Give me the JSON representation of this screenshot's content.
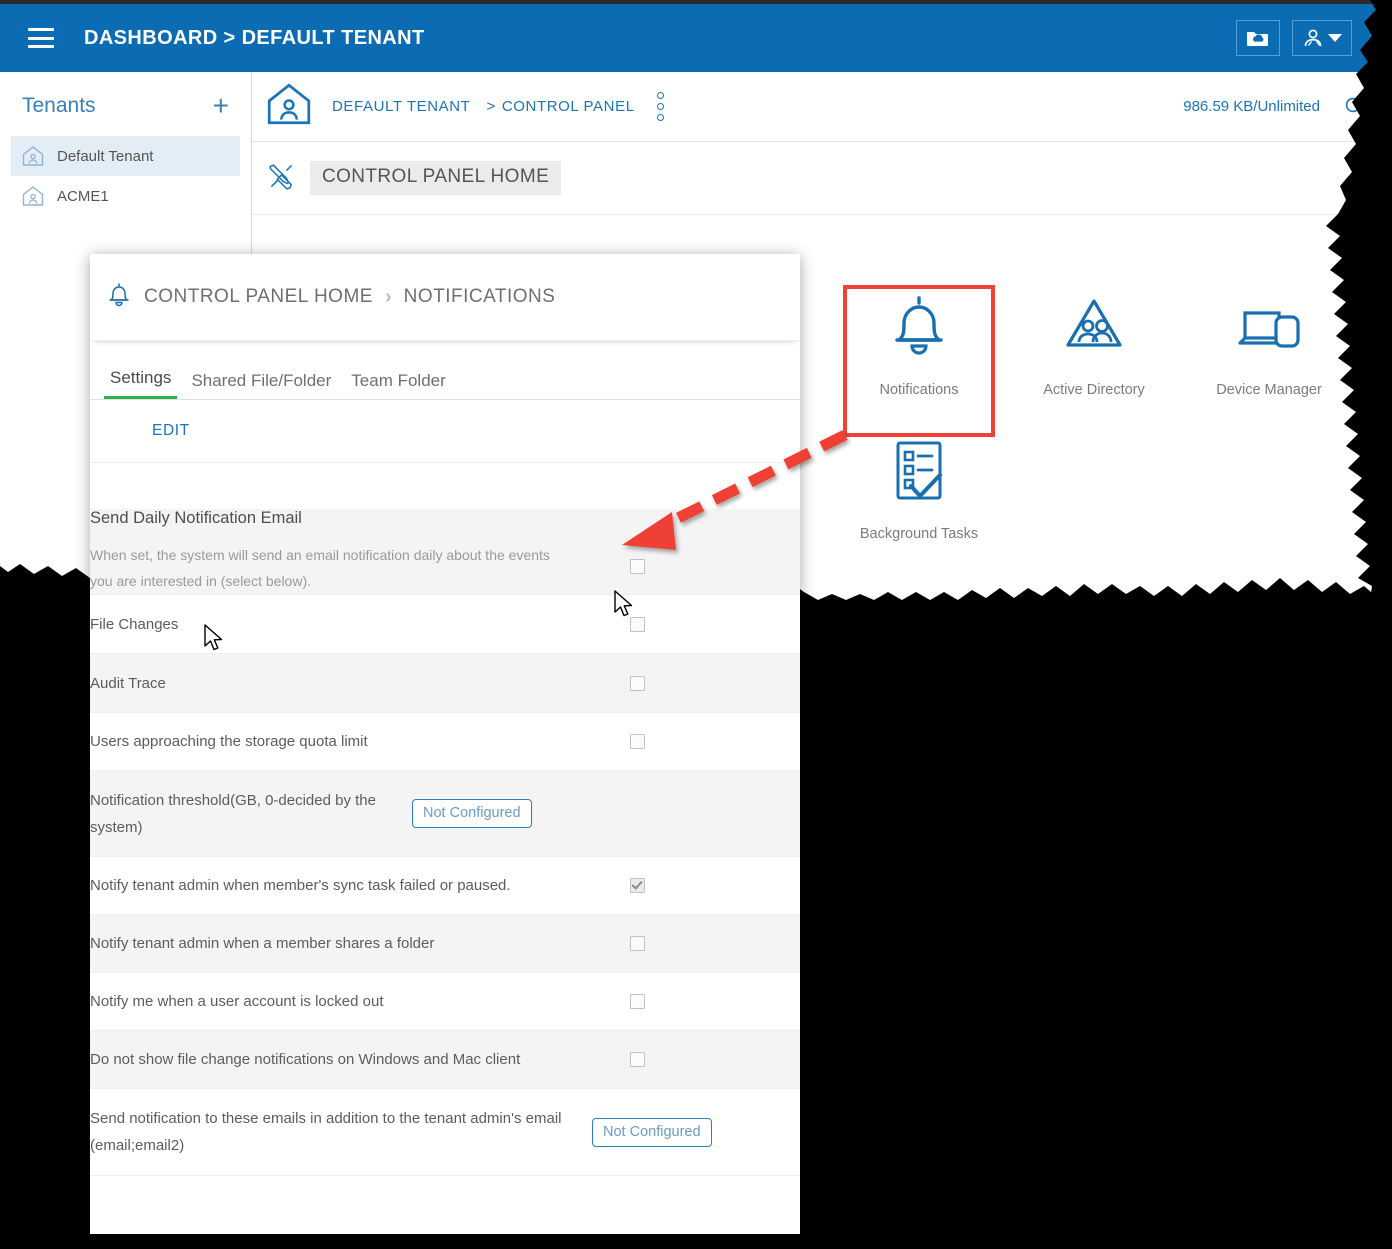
{
  "window": {
    "topbar": {
      "menu_icon": "hamburger-icon",
      "title": "DASHBOARD > DEFAULT TENANT",
      "cloud_folder_icon": "cloud-folder-icon",
      "user_icon": "user-account-icon",
      "caret_icon": "chevron-down-icon"
    }
  },
  "sidebar": {
    "title": "Tenants",
    "add_label": "+",
    "items": [
      {
        "label": "Default Tenant",
        "icon": "tenant-home-icon",
        "active": true
      },
      {
        "label": "ACME1",
        "icon": "tenant-home-icon",
        "active": false
      }
    ]
  },
  "content": {
    "breadcrumb": {
      "home_icon": "tenant-home-icon",
      "item1": "DEFAULT TENANT",
      "separator": ">",
      "item2": "CONTROL PANEL",
      "kebab_icon": "more-vertical-icon"
    },
    "quota": "986.59 KB/Unlimited",
    "search_icon": "search-icon",
    "page_header": {
      "icon": "tools-icon",
      "label": "CONTROL PANEL HOME"
    },
    "close_icon": "close-icon",
    "tiles": [
      {
        "label": "Notifications",
        "icon": "bell-icon",
        "highlighted": true
      },
      {
        "label": "Active Directory",
        "icon": "active-directory-icon",
        "highlighted": false
      },
      {
        "label": "Device Manager",
        "icon": "device-manager-icon",
        "highlighted": false
      },
      {
        "label": "Background Tasks",
        "icon": "background-tasks-icon",
        "highlighted": false
      }
    ]
  },
  "dialog": {
    "breadcrumb": {
      "icon": "bell-icon",
      "item1": "CONTROL PANEL HOME",
      "separator": "›",
      "item2": "NOTIFICATIONS"
    },
    "tabs": [
      {
        "label": "Settings",
        "active": true
      },
      {
        "label": "Shared File/Folder",
        "active": false
      },
      {
        "label": "Team Folder",
        "active": false
      }
    ],
    "edit_label": "EDIT",
    "header_section": {
      "title": "Send Daily Notification Email",
      "description": "When set, the system will send an email notification daily about the events you are interested in (select below).",
      "checkbox_checked": false
    },
    "rows": [
      {
        "label": "File Changes",
        "control": "checkbox",
        "checked": false,
        "indent": true,
        "alt": false
      },
      {
        "label": "Audit Trace",
        "control": "checkbox",
        "checked": false,
        "indent": true,
        "alt": true
      },
      {
        "label": "Users approaching the storage quota limit",
        "control": "checkbox",
        "checked": false,
        "indent": true,
        "alt": false
      },
      {
        "label": "Notification threshold(GB, 0-decided by the system)",
        "control": "button",
        "button_label": "Not Configured",
        "indent": true,
        "alt": true
      },
      {
        "label": "Notify tenant admin when member's sync task failed or paused.",
        "control": "checkbox",
        "checked": true,
        "indent": false,
        "alt": false
      },
      {
        "label": "Notify tenant admin when a member shares a folder",
        "control": "checkbox",
        "checked": false,
        "indent": false,
        "alt": true
      },
      {
        "label": "Notify me when a user account is locked out",
        "control": "checkbox",
        "checked": false,
        "indent": false,
        "alt": false
      },
      {
        "label": "Do not show file change notifications on Windows and Mac client",
        "control": "checkbox",
        "checked": false,
        "indent": false,
        "alt": true
      },
      {
        "label": "Send notification to these emails in addition to the tenant admin's email (email;email2)",
        "control": "button",
        "button_label": "Not Configured",
        "indent": false,
        "alt": false
      }
    ]
  },
  "annotation": {
    "highlight_color": "#ef4136",
    "arrow_color": "#ef4136",
    "arrow_style": "dashed",
    "arrow_from": "notifications-tile",
    "arrow_to": "send-daily-notification-email-checkbox"
  },
  "colors": {
    "brand_blue": "#0b6cb3",
    "link_blue": "#1a74b8",
    "tab_active_green": "#2fb04a",
    "row_alt": "#f4f4f4",
    "text_grey": "#5c5c5c"
  }
}
